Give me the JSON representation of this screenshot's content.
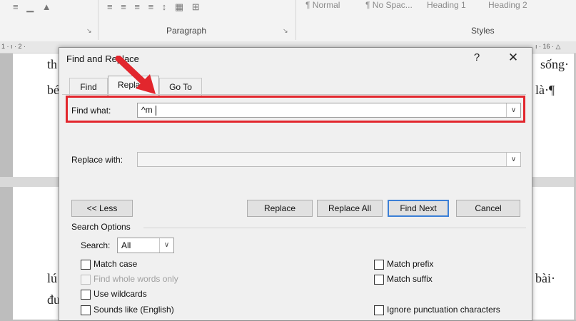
{
  "ribbon": {
    "paragraph_label": "Paragraph",
    "styles_label": "Styles",
    "styles_gallery": [
      "¶ Normal",
      "¶ No Spac...",
      "Heading 1",
      "Heading 2"
    ],
    "launcher_glyph": "↘"
  },
  "ruler": {
    "left_ticks": "1 · ı · 2 ·",
    "right_ticks": "ı · 16 · △"
  },
  "document": {
    "lines": [
      "th",
      "bé",
      "sống·",
      "là·¶",
      "lú",
      "đư",
      "bài·"
    ]
  },
  "dialog": {
    "title": "Find and Replace",
    "help_glyph": "?",
    "close_glyph": "✕",
    "tabs": [
      {
        "label": "Find"
      },
      {
        "label": "Replace"
      },
      {
        "label": "Go To"
      }
    ],
    "find_what_label": "Find what:",
    "find_what_value": "^m",
    "replace_with_label": "Replace with:",
    "replace_with_value": "",
    "buttons": {
      "less": "<< Less",
      "replace": "Replace",
      "replace_all": "Replace All",
      "find_next": "Find Next",
      "cancel": "Cancel"
    },
    "search_options_title": "Search Options",
    "search_label": "Search:",
    "search_value": "All",
    "dropdown_glyph": "∨",
    "checkboxes_left": [
      {
        "label": "Match case",
        "enabled": true
      },
      {
        "label": "Find whole words only",
        "enabled": false
      },
      {
        "label": "Use wildcards",
        "enabled": true
      },
      {
        "label": "Sounds like (English)",
        "enabled": true
      }
    ],
    "checkboxes_right": [
      {
        "label": "Match prefix",
        "enabled": true
      },
      {
        "label": "Match suffix",
        "enabled": true
      },
      {
        "label": "Ignore punctuation characters",
        "enabled": true
      }
    ]
  },
  "colors": {
    "highlight": "#e2262d",
    "default_button_border": "#3b7fd6"
  }
}
